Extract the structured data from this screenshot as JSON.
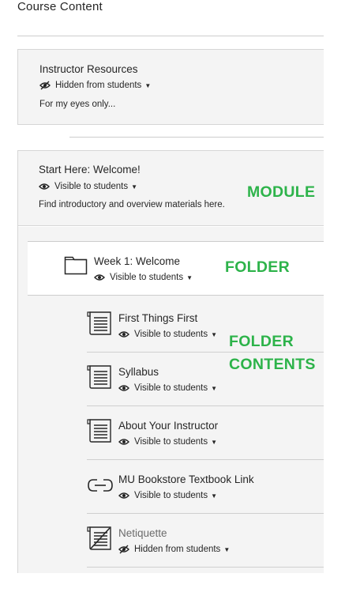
{
  "page": {
    "title": "Course Content"
  },
  "instructor_module": {
    "title": "Instructor Resources",
    "visibility": "Hidden from students",
    "description": "For my eyes only..."
  },
  "welcome_module": {
    "title": "Start Here: Welcome!",
    "visibility": "Visible to students",
    "description": "Find introductory and overview materials here."
  },
  "folder": {
    "title": "Week 1: Welcome",
    "visibility": "Visible to students"
  },
  "items": [
    {
      "title": "First Things First",
      "visibility": "Visible to students",
      "icon": "document-icon"
    },
    {
      "title": "Syllabus",
      "visibility": "Visible to students",
      "icon": "document-icon"
    },
    {
      "title": "About Your Instructor",
      "visibility": "Visible to students",
      "icon": "document-icon"
    },
    {
      "title": "MU Bookstore Textbook Link",
      "visibility": "Visible to students",
      "icon": "link-icon"
    },
    {
      "title": "Netiquette",
      "visibility": "Hidden from students",
      "icon": "hidden-document-icon"
    }
  ],
  "annotations": {
    "module": "MODULE",
    "folder": "FOLDER",
    "folder_contents_line1": "FOLDER",
    "folder_contents_line2": "CONTENTS"
  },
  "colors": {
    "annotation": "#2db34a",
    "card_bg": "#f4f4f4",
    "divider": "#cdcdcd"
  }
}
